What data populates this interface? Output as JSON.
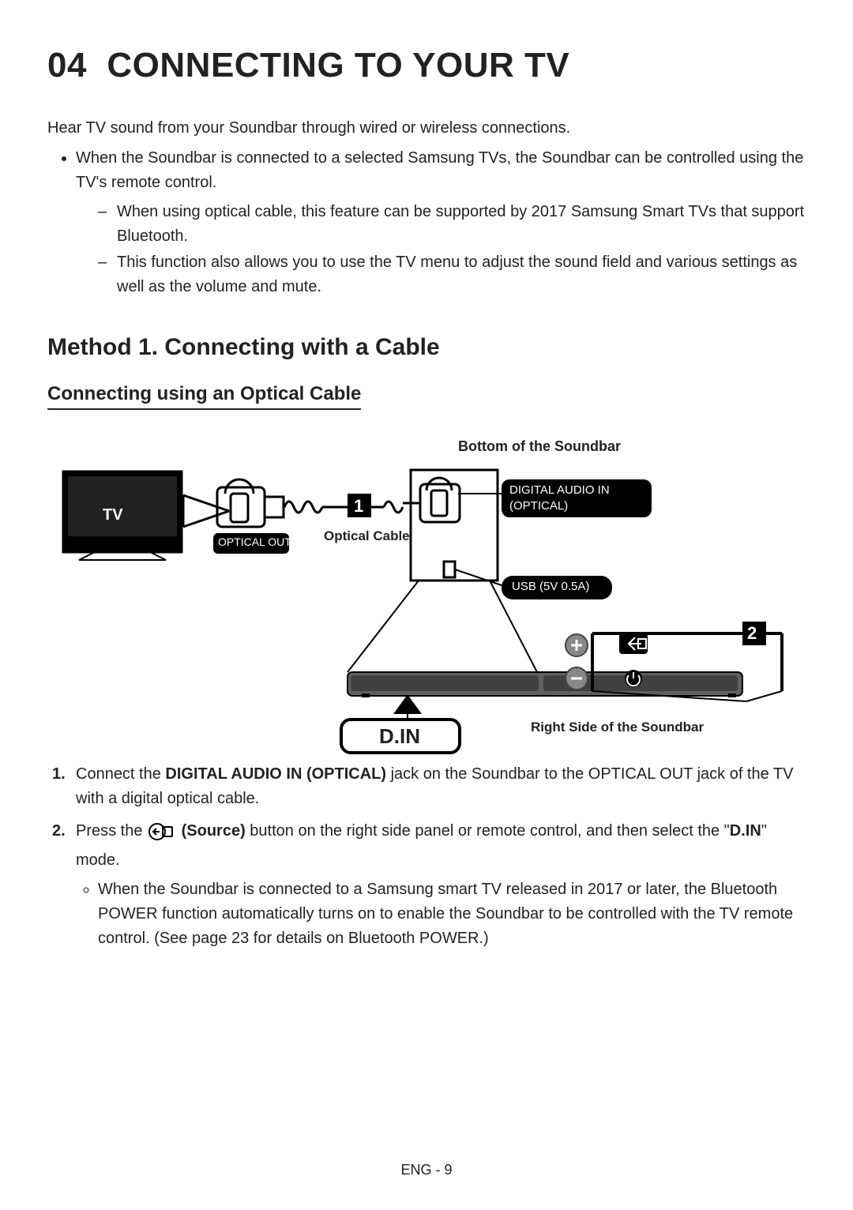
{
  "section": {
    "number": "04",
    "title": "CONNECTING TO YOUR TV"
  },
  "intro": "Hear TV sound from your Soundbar through wired or wireless connections.",
  "bullet1": "When the Soundbar is connected to a selected Samsung TVs, the Soundbar can be controlled using the TV's remote control.",
  "dash1": "When using optical cable, this feature can be supported by 2017 Samsung Smart TVs that support Bluetooth.",
  "dash2": "This function also allows you to use the TV menu to adjust the sound field and various settings as well as the volume and mute.",
  "method_title": "Method 1. Connecting with a Cable",
  "sub_title": "Connecting using an Optical Cable",
  "diagram": {
    "topCaption": "Bottom of the Soundbar",
    "tvLabel": "TV",
    "opticalOut": "OPTICAL OUT",
    "opticalCable": "Optical Cable",
    "step1": "1",
    "digitalAudioIn": "DIGITAL AUDIO IN (OPTICAL)",
    "usb": "USB (5V 0.5A)",
    "step2": "2",
    "din": "D.IN",
    "rightSide": "Right Side of the Soundbar"
  },
  "steps": {
    "s1_a": "Connect the ",
    "s1_b": "DIGITAL AUDIO IN (OPTICAL)",
    "s1_c": " jack on the Soundbar to the OPTICAL OUT jack of the TV with a digital optical cable.",
    "s2_a": "Press the ",
    "s2_b": "(Source)",
    "s2_c": " button on the right side panel or remote control, and then select the \"",
    "s2_d": "D.IN",
    "s2_e": "\" mode.",
    "s2_sub": "When the Soundbar is connected to a Samsung smart TV released in 2017 or later, the Bluetooth POWER function automatically turns on to enable the Soundbar to be controlled with the TV remote control. (See page 23 for details on Bluetooth POWER.)"
  },
  "footer": "ENG - 9"
}
